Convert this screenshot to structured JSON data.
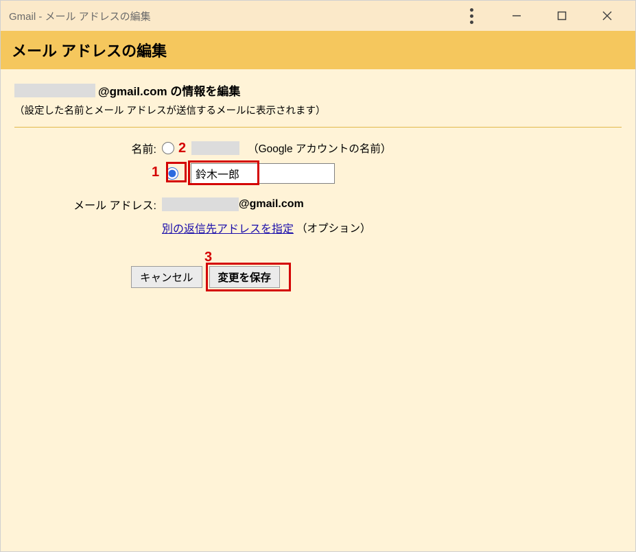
{
  "window": {
    "title": "Gmail - メール アドレスの編集"
  },
  "header": {
    "title": "メール アドレスの編集"
  },
  "section": {
    "title_suffix": "@gmail.com の情報を編集",
    "subtitle": "（設定した名前とメール アドレスが送信するメールに表示されます）"
  },
  "form": {
    "name_label": "名前:",
    "google_account_note": "（Google アカウントの名前）",
    "custom_name_value": "鈴木一郎",
    "email_label": "メール アドレス:",
    "email_suffix": "@gmail.com",
    "reply_link": "別の返信先アドレスを指定",
    "reply_option_note": "（オプション）"
  },
  "buttons": {
    "cancel": "キャンセル",
    "save": "変更を保存"
  },
  "annotations": {
    "one": "1",
    "two": "2",
    "three": "3"
  }
}
